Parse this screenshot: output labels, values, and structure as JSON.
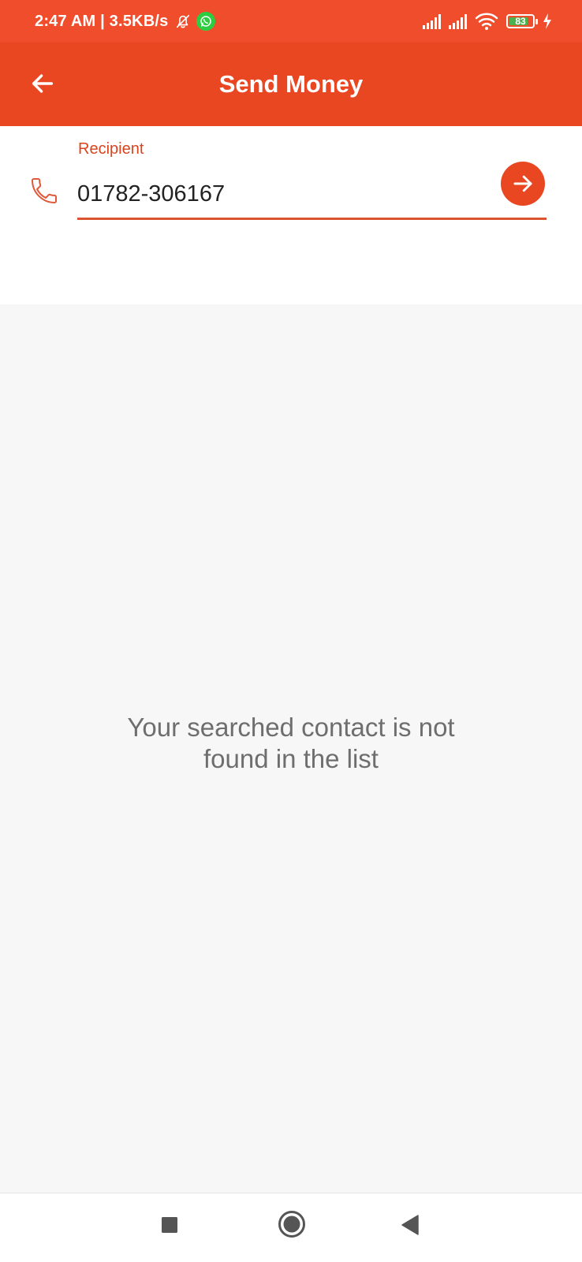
{
  "status_bar": {
    "time_speed": "2:47 AM | 3.5KB/s",
    "battery": "83",
    "battery_level": 0.83,
    "icons": [
      "bell-off-icon",
      "whatsapp-icon",
      "signal-icon",
      "signal-icon",
      "wifi-icon",
      "battery-icon",
      "charging-icon"
    ]
  },
  "app_bar": {
    "title": "Send Money",
    "back_icon": "arrow-left-icon"
  },
  "recipient": {
    "label": "Recipient",
    "value": "01782-306167",
    "icon": "phone-icon",
    "go_icon": "arrow-right-icon"
  },
  "empty_state": {
    "line1": "Your searched contact is not",
    "line2": "found in the list"
  },
  "nav_bar": {
    "icons": [
      "recents-icon",
      "home-icon",
      "back-icon"
    ]
  },
  "colors": {
    "status_bar": "#f04d2c",
    "app_bar": "#e94622",
    "accent": "#d9441f",
    "page_background": "#f7f7f7"
  }
}
